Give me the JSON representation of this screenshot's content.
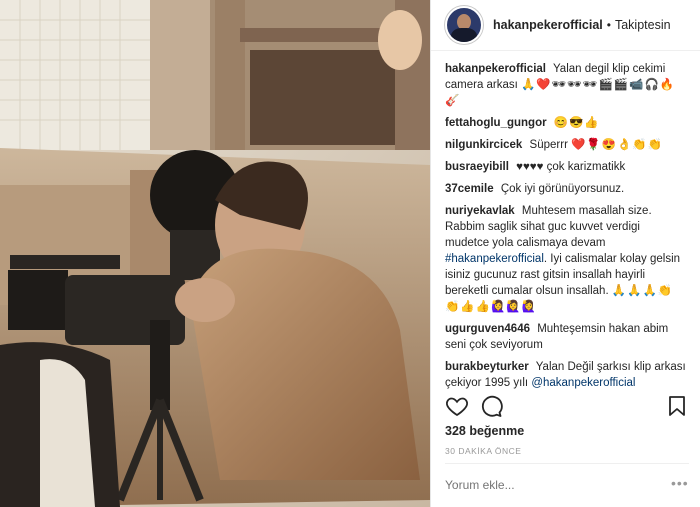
{
  "post": {
    "username": "hakanpekerofficial",
    "separator": "•",
    "follow_status": "Takiptesin",
    "likes": "328 beğenme",
    "time": "30 DAKİKA ÖNCE",
    "comment_placeholder": "Yorum ekle...",
    "more_options": "•••"
  },
  "comments": [
    {
      "user": "hakanpekerofficial",
      "text": "Yalan degil klip cekimi camera arkası",
      "emoji": "🙏❤️🕶🕶🕶🎬🎬📹🎧🔥🎸"
    },
    {
      "user": "fettahoglu_gungor",
      "text": "",
      "emoji": "😊😎👍"
    },
    {
      "user": "nilgunkircicek",
      "text": "Süperrr",
      "emoji": "❤️🌹😍👌👏👏"
    },
    {
      "user": "busraeyibill",
      "text": "♥♥♥♥ çok karizmatikk",
      "emoji": ""
    },
    {
      "user": "37cemile",
      "text": "Çok iyi görünüyorsunuz.",
      "emoji": ""
    },
    {
      "user": "nuriyekavlak",
      "text": "Muhtesem masallah size. Rabbim saglik sihat guc kuvvet verdigi mudetce yola calismaya devam",
      "link": "#hakanpekerofficial",
      "text2": ". Iyi calismalar kolay gelsin isiniz gucunuz rast gitsin insallah hayirli bereketli cumalar olsun insallah.",
      "emoji": "🙏🙏🙏👏👏👍👍🙋‍♀️🙋‍♀️🙋‍♀️"
    },
    {
      "user": "ugurguven4646",
      "text": "Muhteşemsin hakan abim seni çok seviyorum",
      "emoji": ""
    },
    {
      "user": "burakbeyturker",
      "text": "Yalan Değil şarkısı klip arkası çekiyor 1995 yılı",
      "mention": "@hakanpekerofficial",
      "emoji": ""
    }
  ],
  "icons": {
    "heart": "heart-icon",
    "comment": "comment-icon",
    "bookmark": "bookmark-icon"
  },
  "colors": {
    "link": "#003569",
    "muted": "#999999",
    "text": "#262626"
  }
}
